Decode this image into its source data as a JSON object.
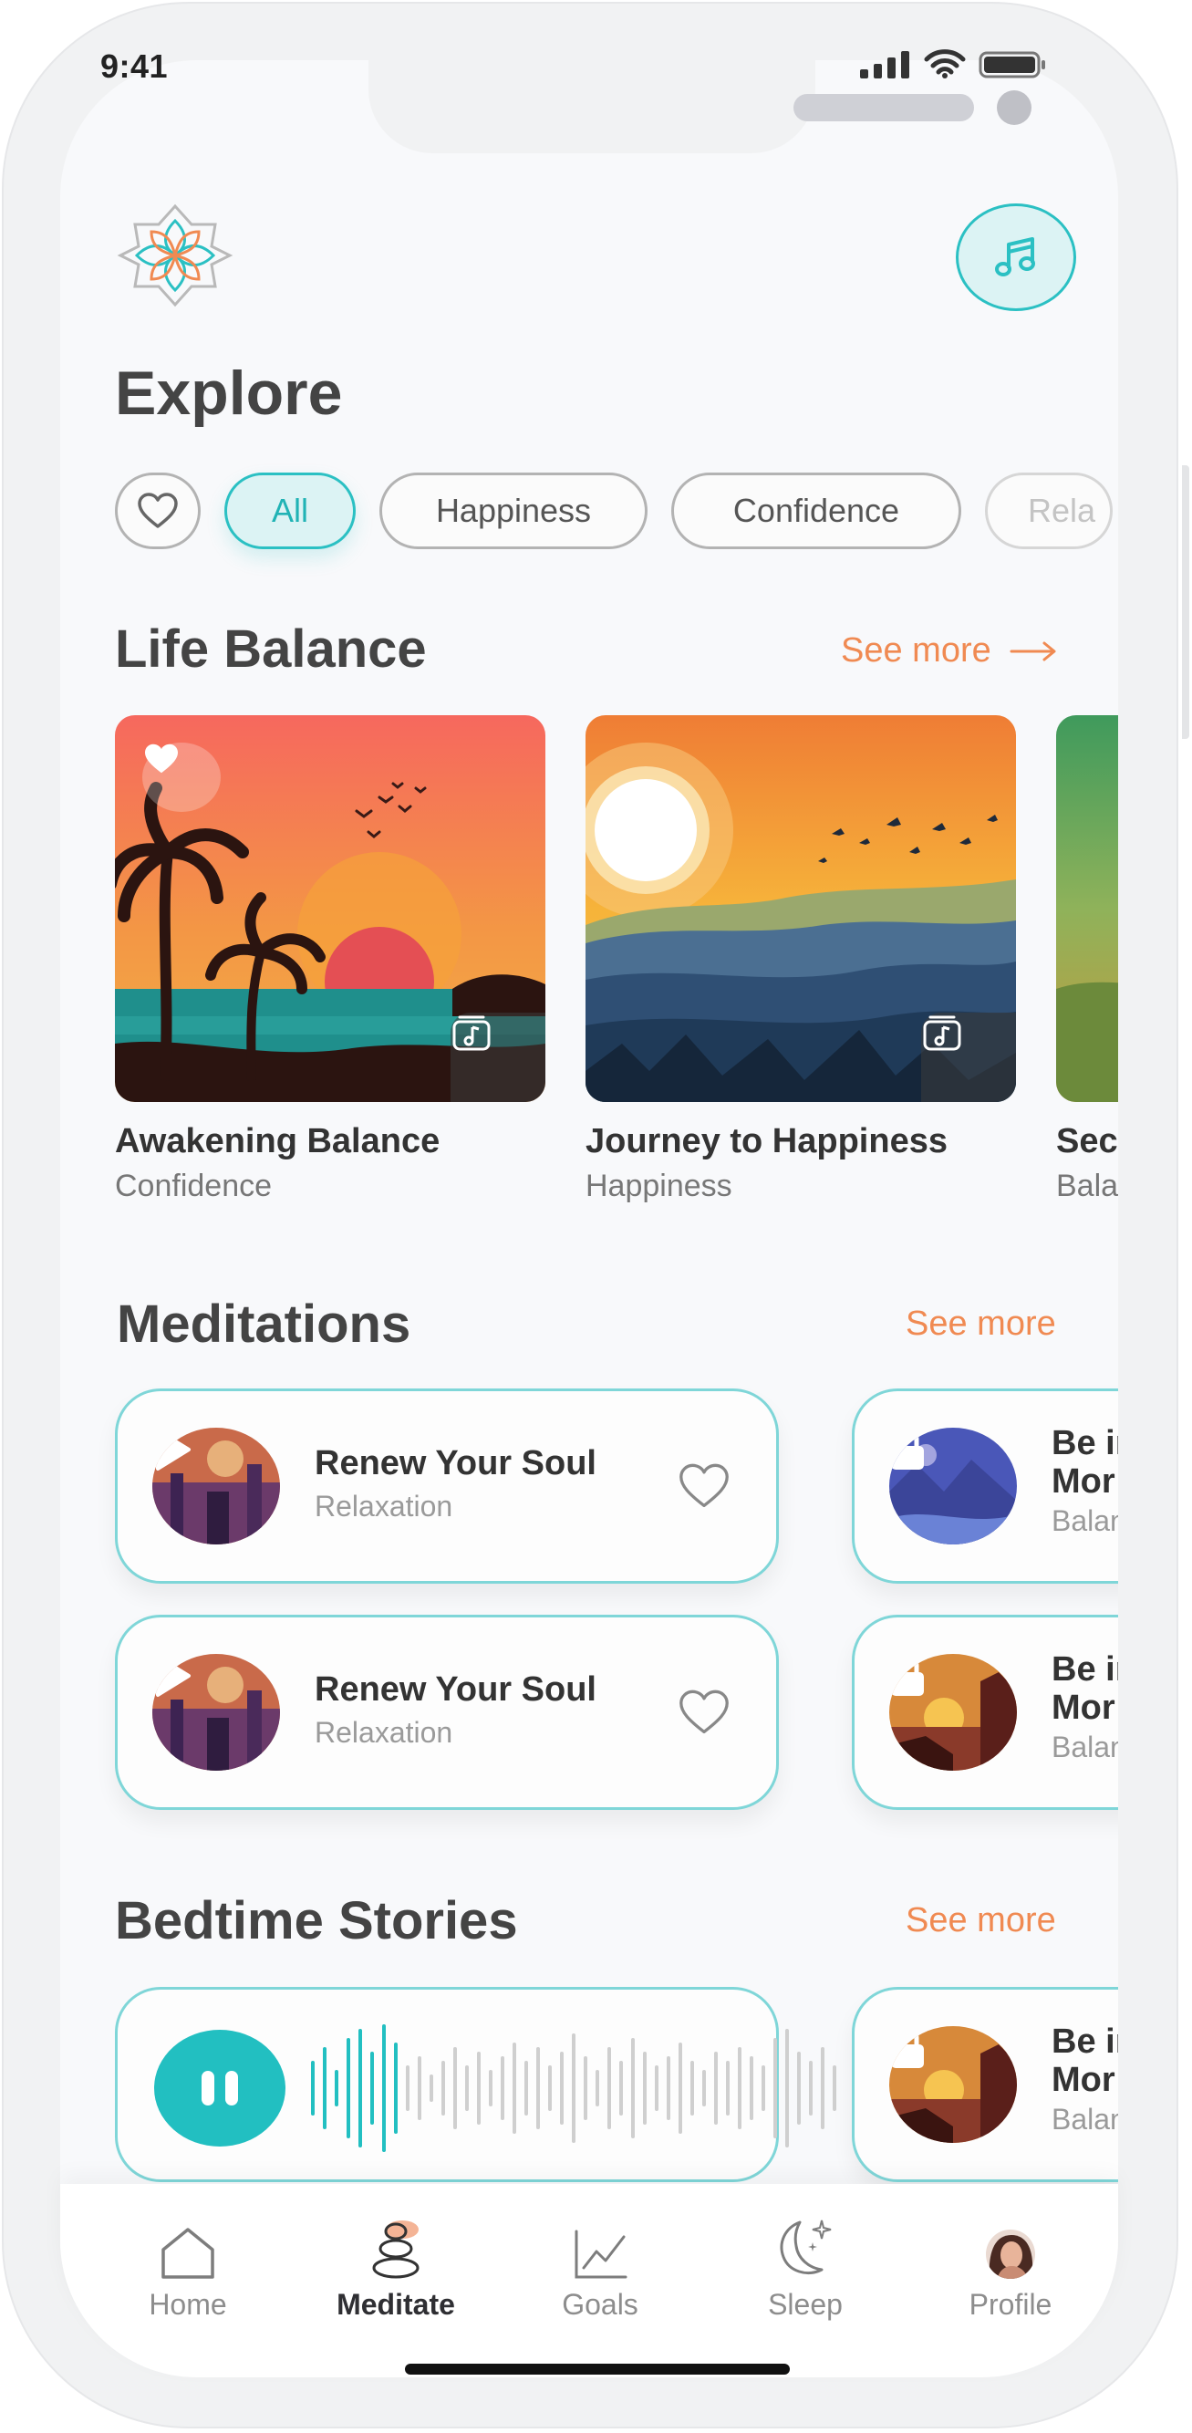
{
  "status_bar": {
    "time": "9:41"
  },
  "header": {
    "title": "Explore"
  },
  "filters": {
    "chips": [
      {
        "label": "All",
        "active": true
      },
      {
        "label": "Happiness",
        "active": false
      },
      {
        "label": "Confidence",
        "active": false
      },
      {
        "label": "Rela",
        "active": false
      }
    ]
  },
  "life_balance": {
    "title": "Life Balance",
    "see_more": "See more",
    "cards": [
      {
        "title": "Awakening Balance",
        "category": "Confidence",
        "favorited": true
      },
      {
        "title": "Journey to Happiness",
        "category": "Happiness",
        "favorited": false
      },
      {
        "title": "Sec",
        "category": "Bala",
        "favorited": false
      }
    ]
  },
  "meditations": {
    "title": "Meditations",
    "see_more": "See more",
    "items": [
      {
        "title": "Renew Your Soul",
        "category": "Relaxation",
        "locked": false
      },
      {
        "title": "Renew Your Soul",
        "category": "Relaxation",
        "locked": false
      },
      {
        "title_line1": "Be in",
        "title_line2": "Mor",
        "category": "Balan",
        "locked": true
      },
      {
        "title_line1": "Be in",
        "title_line2": "Mor",
        "category": "Balan",
        "locked": true
      }
    ]
  },
  "bedtime_stories": {
    "title": "Bedtime Stories",
    "see_more": "See more",
    "player": {
      "state": "playing"
    },
    "item": {
      "title_line1": "Be in",
      "title_line2": "Mor",
      "category": "Balan",
      "locked": true
    }
  },
  "tab_bar": {
    "tabs": [
      {
        "label": "Home",
        "icon": "home-icon",
        "active": false
      },
      {
        "label": "Meditate",
        "icon": "stones-icon",
        "active": true
      },
      {
        "label": "Goals",
        "icon": "chart-icon",
        "active": false
      },
      {
        "label": "Sleep",
        "icon": "moon-icon",
        "active": false
      },
      {
        "label": "Profile",
        "icon": "avatar",
        "active": false
      }
    ]
  },
  "colors": {
    "accent": "#2bc0c3",
    "link": "#f08a52",
    "text": "#444444"
  }
}
